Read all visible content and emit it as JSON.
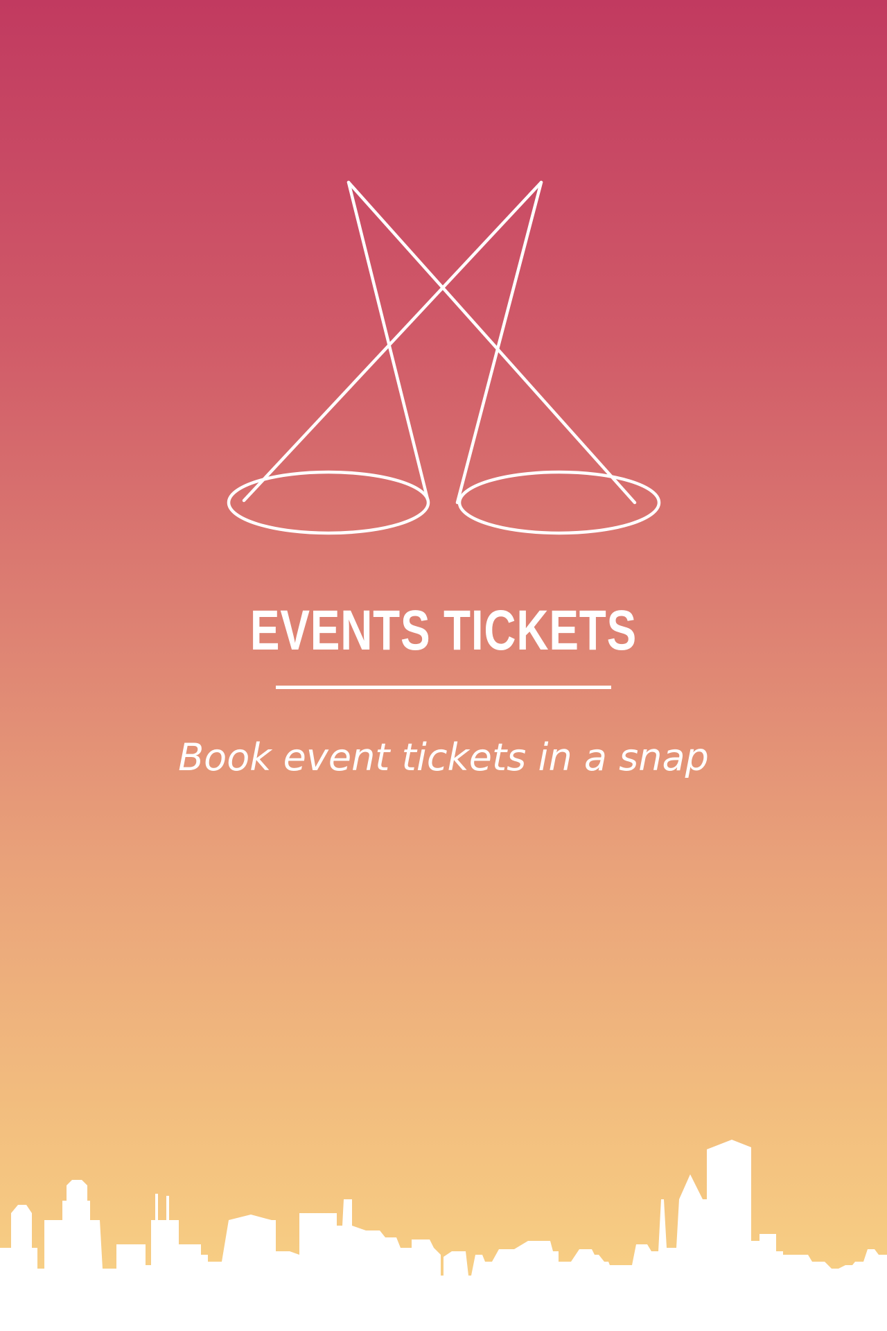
{
  "app": {
    "title": "EVENTS TICKETS",
    "tagline": "Book event tickets in a snap"
  },
  "icons": {
    "logo": "spotlights-icon",
    "skyline": "city-skyline-silhouette"
  },
  "colors": {
    "gradient_top": "#c13a60",
    "gradient_bottom": "#f9d486",
    "foreground": "#ffffff"
  }
}
